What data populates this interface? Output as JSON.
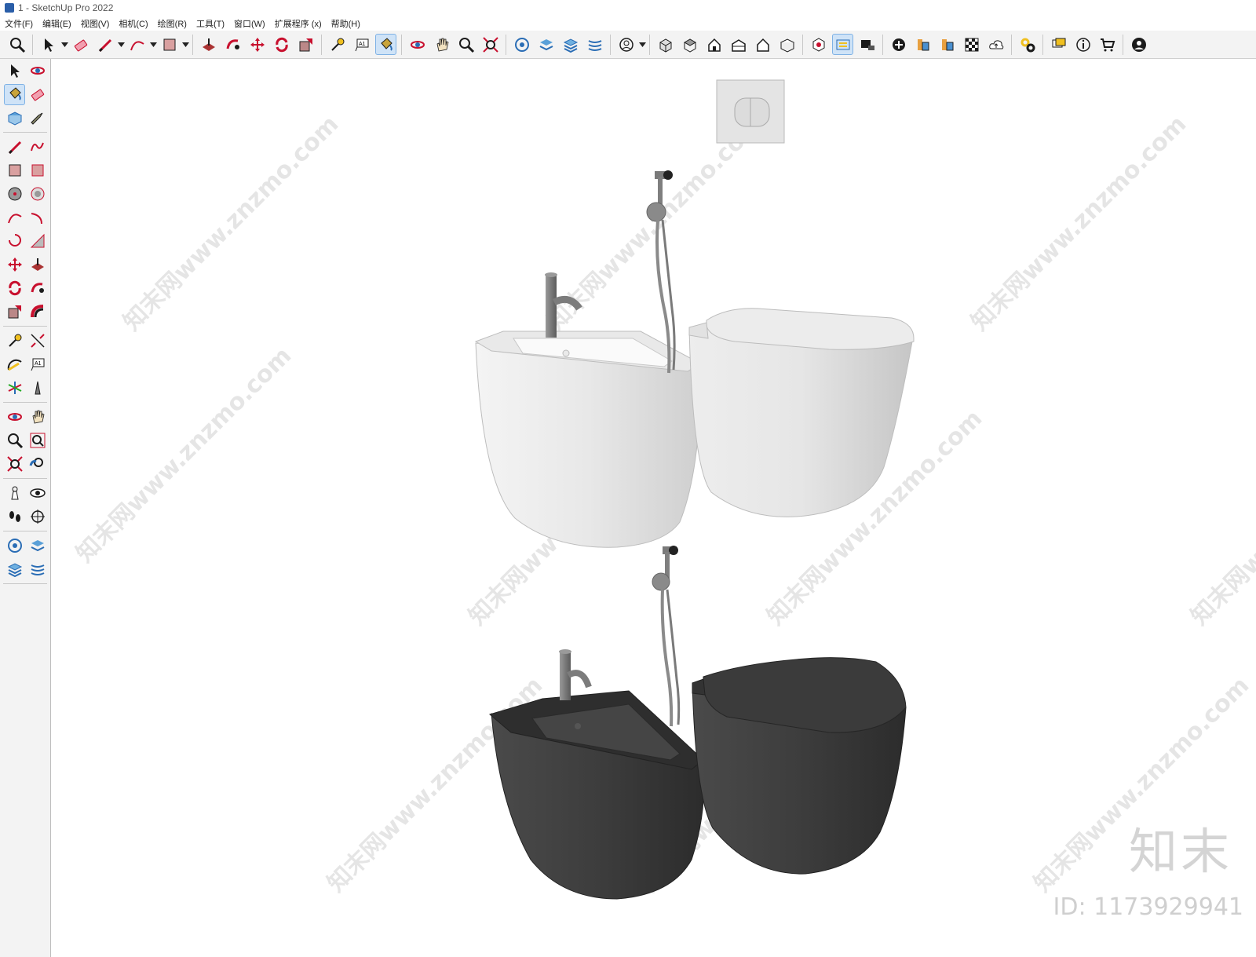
{
  "window": {
    "title": "1 - SketchUp Pro 2022"
  },
  "menu": [
    "文件(F)",
    "编辑(E)",
    "视图(V)",
    "相机(C)",
    "绘图(R)",
    "工具(T)",
    "窗口(W)",
    "扩展程序 (x)",
    "帮助(H)"
  ],
  "toolbar": {
    "items": [
      "zoom-icon",
      "select-icon",
      "eraser-icon",
      "pencil-icon",
      "arc-icon",
      "rectangle-icon",
      "push-pull-icon",
      "follow-me-icon",
      "move-icon",
      "rotate-icon",
      "scale-icon",
      "tape-measure-icon",
      "text-icon",
      "paint-bucket-icon",
      "orbit-icon",
      "pan-icon",
      "zoom-tool-icon",
      "zoom-extents-icon",
      "warehouse-icon",
      "extension-warehouse-icon",
      "layer-icon",
      "sandbox-icon",
      "user-icon",
      "iso-view-icon",
      "top-view-icon",
      "front-view-icon",
      "right-view-icon",
      "back-view-icon",
      "left-view-icon",
      "components-icon",
      "section-icon",
      "scenes-icon",
      "add-location-icon",
      "style-icon",
      "materials-icon",
      "shadows-icon",
      "cloud-icon",
      "settings-icon",
      "dialog-icon",
      "info-icon",
      "cart-icon",
      "account-icon"
    ]
  },
  "lefttools": {
    "items": [
      "select-icon",
      "orbit-icon",
      "paint-bucket-icon",
      "eraser-icon",
      "component-icon",
      "tag-icon",
      "pencil-icon",
      "freehand-icon",
      "rectangle-icon",
      "rotated-rectangle-icon",
      "circle-icon",
      "polygon-icon",
      "arc-icon",
      "two-point-arc-icon",
      "pie-icon",
      "three-point-arc-icon",
      "move-icon",
      "push-pull-icon",
      "rotate-icon",
      "follow-me-icon",
      "scale-icon",
      "offset-icon",
      "tape-measure-icon",
      "dimension-icon",
      "protractor-icon",
      "text-icon",
      "axes-icon",
      "3d-text-icon",
      "orbit-tool-icon",
      "pan-icon",
      "zoom-icon",
      "zoom-window-icon",
      "zoom-extents-icon",
      "previous-view-icon",
      "position-camera-icon",
      "look-around-icon",
      "walk-icon",
      "section-plane-icon",
      "warehouse-icon",
      "extension-icon",
      "layer-icon",
      "sandbox-icon"
    ]
  },
  "colors": {
    "white_fixture": "#d9d9d9",
    "black_fixture": "#3e3e3e",
    "accent": "#c8102e"
  },
  "watermark": {
    "site": "www.znzmo.com",
    "name": "知末网",
    "brand": "知末",
    "id": "ID: 1173929941"
  }
}
